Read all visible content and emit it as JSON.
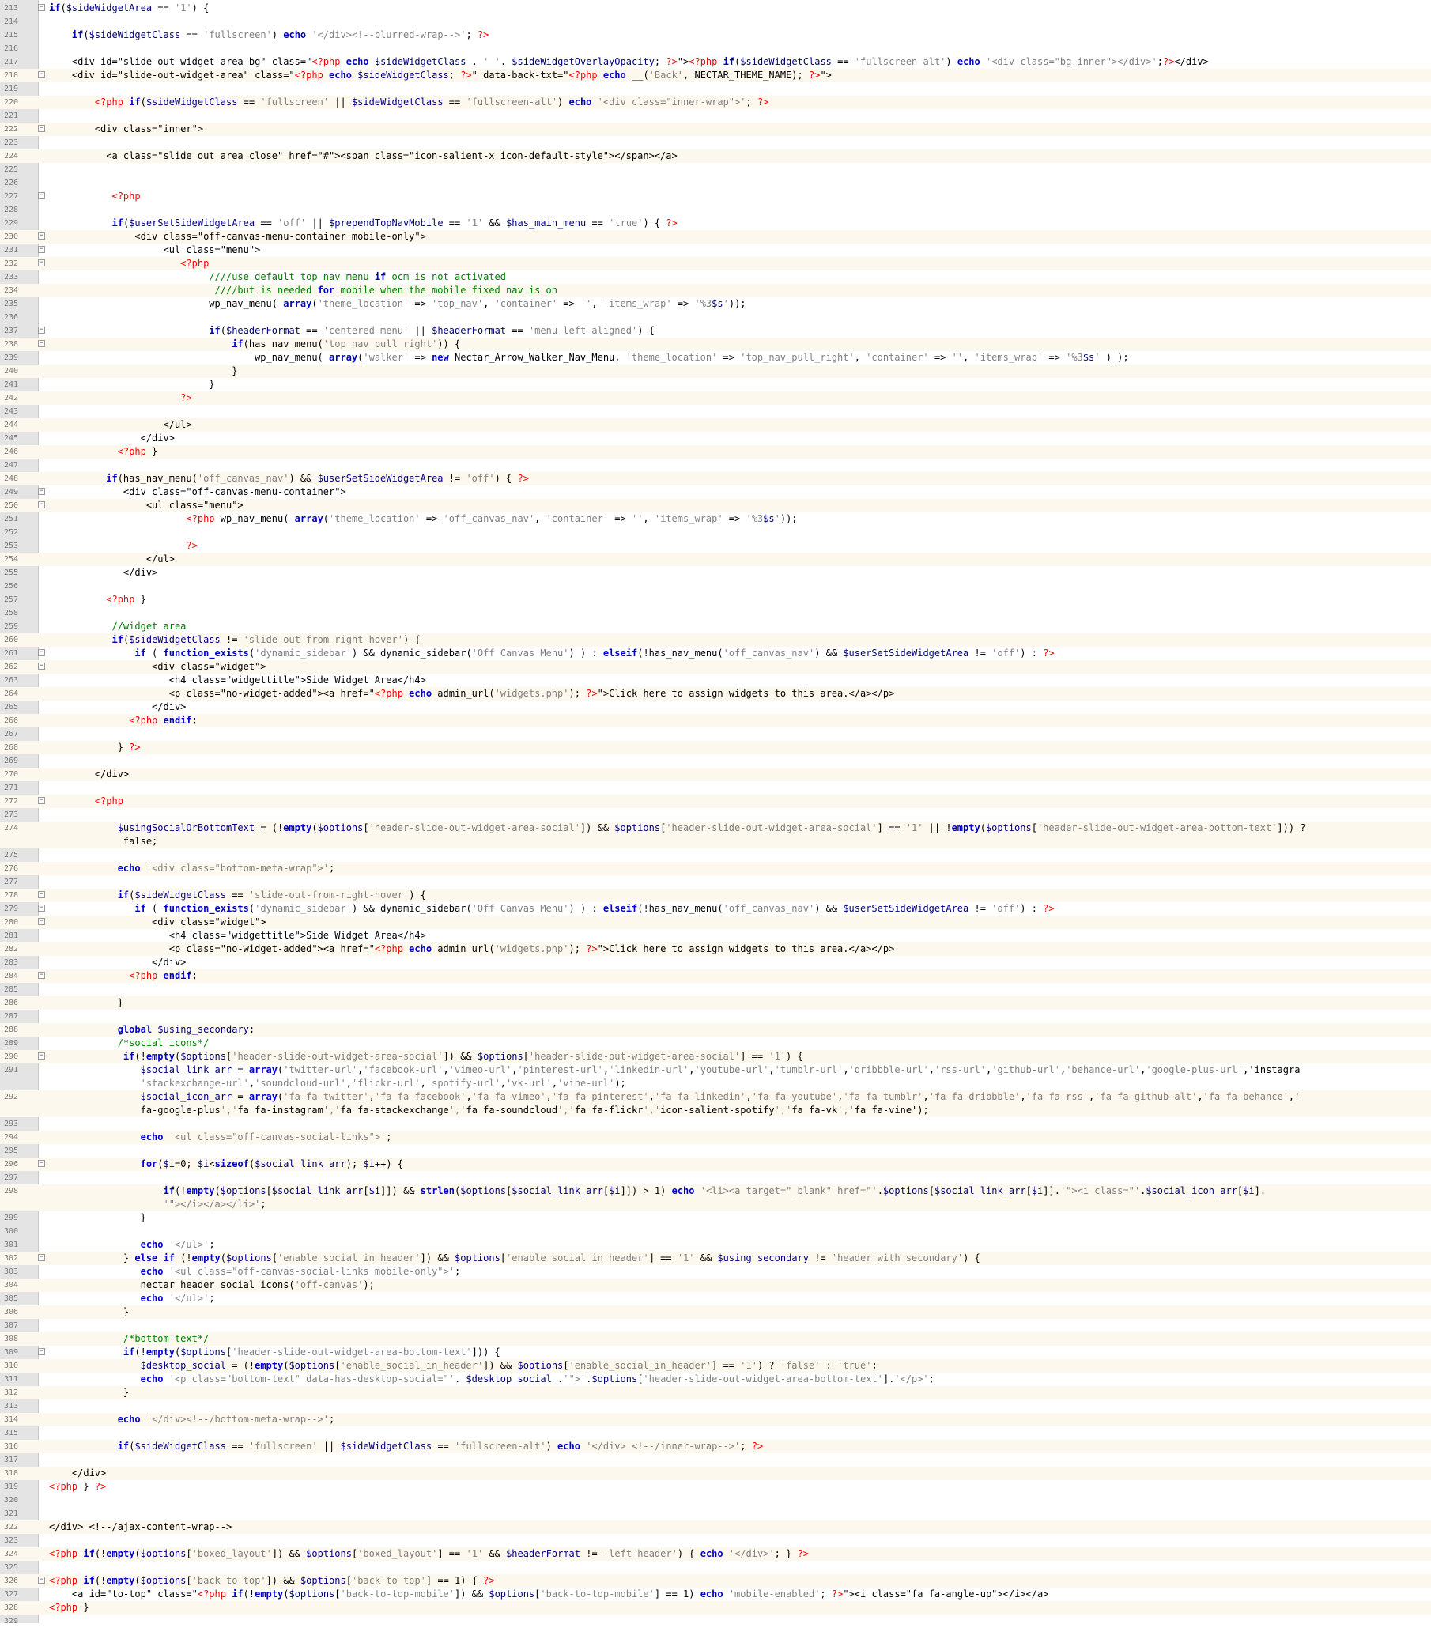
{
  "editor": {
    "lines": [
      {
        "n": "213",
        "t": "if($sideWidgetArea == '1') {",
        "fold": true
      },
      {
        "n": "214",
        "t": ""
      },
      {
        "n": "215",
        "t": "    if($sideWidgetClass == 'fullscreen') echo '</div><!--blurred-wrap-->'; ?>"
      },
      {
        "n": "216",
        "t": ""
      },
      {
        "n": "217",
        "t": "    <div id=\"slide-out-widget-area-bg\" class=\"<?php echo $sideWidgetClass . ' '. $sideWidgetOverlayOpacity; ?>\"><?php if($sideWidgetClass == 'fullscreen-alt') echo '<div class=\"bg-inner\"></div>';?></div>"
      },
      {
        "n": "218",
        "t": "    <div id=\"slide-out-widget-area\" class=\"<?php echo $sideWidgetClass; ?>\" data-back-txt=\"<?php echo __('Back', NECTAR_THEME_NAME); ?>\">",
        "fold": true
      },
      {
        "n": "219",
        "t": ""
      },
      {
        "n": "220",
        "t": "        <?php if($sideWidgetClass == 'fullscreen' || $sideWidgetClass == 'fullscreen-alt') echo '<div class=\"inner-wrap\">'; ?>"
      },
      {
        "n": "221",
        "t": ""
      },
      {
        "n": "222",
        "t": "        <div class=\"inner\">",
        "fold": true
      },
      {
        "n": "223",
        "t": ""
      },
      {
        "n": "224",
        "t": "          <a class=\"slide_out_area_close\" href=\"#\"><span class=\"icon-salient-x icon-default-style\"></span></a>"
      },
      {
        "n": "225",
        "t": ""
      },
      {
        "n": "226",
        "t": ""
      },
      {
        "n": "227",
        "t": "           <?php",
        "fold": true
      },
      {
        "n": "228",
        "t": ""
      },
      {
        "n": "229",
        "t": "           if($userSetSideWidgetArea == 'off' || $prependTopNavMobile == '1' && $has_main_menu == 'true') { ?>"
      },
      {
        "n": "230",
        "t": "               <div class=\"off-canvas-menu-container mobile-only\">",
        "fold": true
      },
      {
        "n": "231",
        "t": "                    <ul class=\"menu\">",
        "fold": true
      },
      {
        "n": "232",
        "t": "                       <?php",
        "fold": true
      },
      {
        "n": "233",
        "t": "                            ////use default top nav menu if ocm is not activated"
      },
      {
        "n": "234",
        "t": "                             ////but is needed for mobile when the mobile fixed nav is on"
      },
      {
        "n": "235",
        "t": "                            wp_nav_menu( array('theme_location' => 'top_nav', 'container' => '', 'items_wrap' => '%3$s'));"
      },
      {
        "n": "236",
        "t": ""
      },
      {
        "n": "237",
        "t": "                            if($headerFormat == 'centered-menu' || $headerFormat == 'menu-left-aligned') {",
        "fold": true
      },
      {
        "n": "238",
        "t": "                                if(has_nav_menu('top_nav_pull_right')) {",
        "fold": true
      },
      {
        "n": "239",
        "t": "                                    wp_nav_menu( array('walker' => new Nectar_Arrow_Walker_Nav_Menu, 'theme_location' => 'top_nav_pull_right', 'container' => '', 'items_wrap' => '%3$s' ) );"
      },
      {
        "n": "240",
        "t": "                                }"
      },
      {
        "n": "241",
        "t": "                            }"
      },
      {
        "n": "242",
        "t": "                       ?>"
      },
      {
        "n": "243",
        "t": ""
      },
      {
        "n": "244",
        "t": "                    </ul>"
      },
      {
        "n": "245",
        "t": "                </div>"
      },
      {
        "n": "246",
        "t": "            <?php }"
      },
      {
        "n": "247",
        "t": ""
      },
      {
        "n": "248",
        "t": "          if(has_nav_menu('off_canvas_nav') && $userSetSideWidgetArea != 'off') { ?>"
      },
      {
        "n": "249",
        "t": "             <div class=\"off-canvas-menu-container\">",
        "fold": true
      },
      {
        "n": "250",
        "t": "                 <ul class=\"menu\">",
        "fold": true
      },
      {
        "n": "251",
        "t": "                        <?php wp_nav_menu( array('theme_location' => 'off_canvas_nav', 'container' => '', 'items_wrap' => '%3$s'));"
      },
      {
        "n": "252",
        "t": ""
      },
      {
        "n": "253",
        "t": "                        ?>"
      },
      {
        "n": "254",
        "t": "                 </ul>"
      },
      {
        "n": "255",
        "t": "             </div>"
      },
      {
        "n": "256",
        "t": ""
      },
      {
        "n": "257",
        "t": "          <?php }"
      },
      {
        "n": "258",
        "t": ""
      },
      {
        "n": "259",
        "t": "           //widget area"
      },
      {
        "n": "260",
        "t": "           if($sideWidgetClass != 'slide-out-from-right-hover') {"
      },
      {
        "n": "261",
        "t": "               if ( function_exists('dynamic_sidebar') && dynamic_sidebar('Off Canvas Menu') ) : elseif(!has_nav_menu('off_canvas_nav') && $userSetSideWidgetArea != 'off') : ?>",
        "fold": true
      },
      {
        "n": "262",
        "t": "                  <div class=\"widget\">",
        "fold": true
      },
      {
        "n": "263",
        "t": "                     <h4 class=\"widgettitle\">Side Widget Area</h4>"
      },
      {
        "n": "264",
        "t": "                     <p class=\"no-widget-added\"><a href=\"<?php echo admin_url('widgets.php'); ?>\">Click here to assign widgets to this area.</a></p>"
      },
      {
        "n": "265",
        "t": "                  </div>"
      },
      {
        "n": "266",
        "t": "              <?php endif;"
      },
      {
        "n": "267",
        "t": ""
      },
      {
        "n": "268",
        "t": "            } ?>"
      },
      {
        "n": "269",
        "t": ""
      },
      {
        "n": "270",
        "t": "        </div>"
      },
      {
        "n": "271",
        "t": ""
      },
      {
        "n": "272",
        "t": "        <?php",
        "fold": true
      },
      {
        "n": "273",
        "t": ""
      },
      {
        "n": "274",
        "t": "            $usingSocialOrBottomText = (!empty($options['header-slide-out-widget-area-social']) && $options['header-slide-out-widget-area-social'] == '1' || !empty($options['header-slide-out-widget-area-bottom-text'])) ?",
        "t2": "             false;",
        "tall": true
      },
      {
        "n": "275",
        "t": ""
      },
      {
        "n": "276",
        "t": "            echo '<div class=\"bottom-meta-wrap\">';"
      },
      {
        "n": "277",
        "t": ""
      },
      {
        "n": "278",
        "t": "            if($sideWidgetClass == 'slide-out-from-right-hover') {",
        "fold": true
      },
      {
        "n": "279",
        "t": "               if ( function_exists('dynamic_sidebar') && dynamic_sidebar('Off Canvas Menu') ) : elseif(!has_nav_menu('off_canvas_nav') && $userSetSideWidgetArea != 'off') : ?>",
        "fold": true
      },
      {
        "n": "280",
        "t": "                  <div class=\"widget\">",
        "fold": true
      },
      {
        "n": "281",
        "t": "                     <h4 class=\"widgettitle\">Side Widget Area</h4>"
      },
      {
        "n": "282",
        "t": "                     <p class=\"no-widget-added\"><a href=\"<?php echo admin_url('widgets.php'); ?>\">Click here to assign widgets to this area.</a></p>"
      },
      {
        "n": "283",
        "t": "                  </div>"
      },
      {
        "n": "284",
        "t": "              <?php endif;",
        "fold": true
      },
      {
        "n": "285",
        "t": ""
      },
      {
        "n": "286",
        "t": "            }"
      },
      {
        "n": "287",
        "t": ""
      },
      {
        "n": "288",
        "t": "            global $using_secondary;"
      },
      {
        "n": "289",
        "t": "            /*social icons*/"
      },
      {
        "n": "290",
        "t": "             if(!empty($options['header-slide-out-widget-area-social']) && $options['header-slide-out-widget-area-social'] == '1') {",
        "fold": true
      },
      {
        "n": "291",
        "t": "                $social_link_arr = array('twitter-url','facebook-url','vimeo-url','pinterest-url','linkedin-url','youtube-url','tumblr-url','dribbble-url','rss-url','github-url','behance-url','google-plus-url','instagra",
        "t2": "                'stackexchange-url','soundcloud-url','flickr-url','spotify-url','vk-url','vine-url');",
        "tall": true
      },
      {
        "n": "292",
        "t": "                $social_icon_arr = array('fa fa-twitter','fa fa-facebook','fa fa-vimeo','fa fa-pinterest','fa fa-linkedin','fa fa-youtube','fa fa-tumblr','fa fa-dribbble','fa fa-rss','fa fa-github-alt','fa fa-behance','",
        "t2": "                fa-google-plus','fa fa-instagram','fa fa-stackexchange','fa fa-soundcloud','fa fa-flickr','icon-salient-spotify','fa fa-vk','fa fa-vine');",
        "tall": true
      },
      {
        "n": "293",
        "t": ""
      },
      {
        "n": "294",
        "t": "                echo '<ul class=\"off-canvas-social-links\">';"
      },
      {
        "n": "295",
        "t": ""
      },
      {
        "n": "296",
        "t": "                for($i=0; $i<sizeof($social_link_arr); $i++) {",
        "fold": true
      },
      {
        "n": "297",
        "t": ""
      },
      {
        "n": "298",
        "t": "                    if(!empty($options[$social_link_arr[$i]]) && strlen($options[$social_link_arr[$i]]) > 1) echo '<li><a target=\"_blank\" href=\"'.$options[$social_link_arr[$i]].'\"><i class=\"'.$social_icon_arr[$i].",
        "t2": "                    '\"></i></a></li>';",
        "tall": true
      },
      {
        "n": "299",
        "t": "                }"
      },
      {
        "n": "300",
        "t": ""
      },
      {
        "n": "301",
        "t": "                echo '</ul>';"
      },
      {
        "n": "302",
        "t": "             } else if (!empty($options['enable_social_in_header']) && $options['enable_social_in_header'] == '1' && $using_secondary != 'header_with_secondary') {",
        "fold": true
      },
      {
        "n": "303",
        "t": "                echo '<ul class=\"off-canvas-social-links mobile-only\">';"
      },
      {
        "n": "304",
        "t": "                nectar_header_social_icons('off-canvas');"
      },
      {
        "n": "305",
        "t": "                echo '</ul>';"
      },
      {
        "n": "306",
        "t": "             }"
      },
      {
        "n": "307",
        "t": ""
      },
      {
        "n": "308",
        "t": "             /*bottom text*/"
      },
      {
        "n": "309",
        "t": "             if(!empty($options['header-slide-out-widget-area-bottom-text'])) {",
        "fold": true
      },
      {
        "n": "310",
        "t": "                $desktop_social = (!empty($options['enable_social_in_header']) && $options['enable_social_in_header'] == '1') ? 'false' : 'true';"
      },
      {
        "n": "311",
        "t": "                echo '<p class=\"bottom-text\" data-has-desktop-social=\"'. $desktop_social .'\">'.$options['header-slide-out-widget-area-bottom-text'].'</p>';"
      },
      {
        "n": "312",
        "t": "             }"
      },
      {
        "n": "313",
        "t": ""
      },
      {
        "n": "314",
        "t": "            echo '</div><!--/bottom-meta-wrap-->';"
      },
      {
        "n": "315",
        "t": ""
      },
      {
        "n": "316",
        "t": "            if($sideWidgetClass == 'fullscreen' || $sideWidgetClass == 'fullscreen-alt') echo '</div> <!--/inner-wrap-->'; ?>"
      },
      {
        "n": "317",
        "t": ""
      },
      {
        "n": "318",
        "t": "    </div>"
      },
      {
        "n": "319",
        "t": "<?php } ?>"
      },
      {
        "n": "320",
        "t": ""
      },
      {
        "n": "321",
        "t": ""
      },
      {
        "n": "322",
        "t": "</div> <!--/ajax-content-wrap-->"
      },
      {
        "n": "323",
        "t": ""
      },
      {
        "n": "324",
        "t": "<?php if(!empty($options['boxed_layout']) && $options['boxed_layout'] == '1' && $headerFormat != 'left-header') { echo '</div>'; } ?>"
      },
      {
        "n": "325",
        "t": ""
      },
      {
        "n": "326",
        "t": "<?php if(!empty($options['back-to-top']) && $options['back-to-top'] == 1) { ?>",
        "fold": true
      },
      {
        "n": "327",
        "t": "    <a id=\"to-top\" class=\"<?php if(!empty($options['back-to-top-mobile']) && $options['back-to-top-mobile'] == 1) echo 'mobile-enabled'; ?>\"><i class=\"fa fa-angle-up\"></i></a>"
      },
      {
        "n": "328",
        "t": "<?php }"
      },
      {
        "n": "329",
        "t": ""
      }
    ]
  }
}
